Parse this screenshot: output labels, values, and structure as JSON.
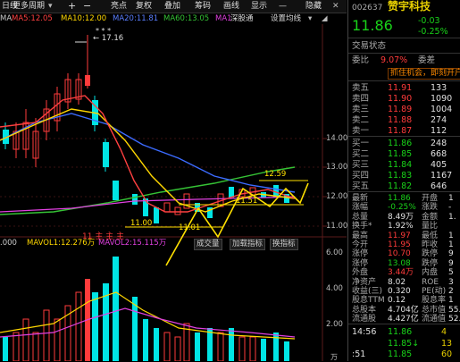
{
  "toolbar": {
    "items": [
      "日线",
      "更多周期",
      "+",
      "−",
      "亮点",
      "复权",
      "叠加",
      "筹码",
      "画线",
      "显示",
      "—",
      "隐藏"
    ],
    "dropdown_icon": "chevron-down-icon",
    "window_icons": [
      "close-icon",
      "layout-icon"
    ]
  },
  "ma_legend": {
    "prefix": "MA",
    "ma5": "MA5:12.05",
    "ma10": "MA10:12.00",
    "ma20": "MA20:11.81",
    "ma60": "MA60:13.05",
    "ma1": "MA1",
    "ma_tag": "深股通",
    "settings": "设置均线",
    "colors": {
      "ma5": "#ff4040",
      "ma10": "#ffd700",
      "ma20": "#3b6bff",
      "ma60": "#35c235",
      "ma1": "#e040e0"
    }
  },
  "chart": {
    "price_labels": [
      "14.00",
      "13.00",
      "12.00",
      "11.00"
    ],
    "max_label": "17.16",
    "right_label": "12.59",
    "low_label": "11.00",
    "low_label2": "11.01",
    "mid_label": "11.51",
    "red_mark": "11 主 主 主"
  },
  "volume": {
    "prefix": ".000",
    "mavol1": "MAVOL1:12.276万",
    "mavol2": "MAVOL2:15.115万",
    "buttons": [
      "成交量",
      "加载指标",
      "换指标"
    ],
    "axis_labels": [
      "6.00",
      "4.00",
      "2.00"
    ],
    "unit": "万"
  },
  "quote": {
    "code": "002637",
    "name": "赞宇科技",
    "price": "11.86",
    "change": "-0.03",
    "change_pct": "-0.25%",
    "trade_status_label": "交易状态",
    "weibi_label": "委比",
    "weibi": "9.07%",
    "weicha_label": "委差",
    "banner": "抓住机会，即刻开户！",
    "sells": [
      {
        "label": "卖五",
        "price": "11.91",
        "vol": "133"
      },
      {
        "label": "卖四",
        "price": "11.90",
        "vol": "1090"
      },
      {
        "label": "卖三",
        "price": "11.89",
        "vol": "1004"
      },
      {
        "label": "卖二",
        "price": "11.88",
        "vol": "274"
      },
      {
        "label": "卖一",
        "price": "11.87",
        "vol": "112"
      }
    ],
    "buys": [
      {
        "label": "买一",
        "price": "11.86",
        "vol": "248"
      },
      {
        "label": "买二",
        "price": "11.85",
        "vol": "668"
      },
      {
        "label": "买三",
        "price": "11.84",
        "vol": "405"
      },
      {
        "label": "买四",
        "price": "11.83",
        "vol": "1167"
      },
      {
        "label": "买五",
        "price": "11.82",
        "vol": "646"
      }
    ],
    "stats": [
      {
        "l": "最新",
        "v": "11.86",
        "l2": "开盘",
        "v2": "1"
      },
      {
        "l": "涨幅",
        "v": "-0.25%",
        "l2": "涨跌",
        "v2": "-"
      },
      {
        "l": "总量",
        "v": "8.49万",
        "l2": "金额",
        "v2": "1."
      },
      {
        "l": "换手*",
        "v": "1.92%",
        "l2": "量比",
        "v2": ""
      },
      {
        "l": "最高",
        "v": "11.97",
        "l2": "最低",
        "v2": "1"
      },
      {
        "l": "今开",
        "v": "11.95",
        "l2": "昨收",
        "v2": "1"
      },
      {
        "l": "涨停",
        "v": "10.70",
        "l2": "跌停",
        "v2": "9"
      },
      {
        "l": "涨停",
        "v": "13.08",
        "l2": "跌停",
        "v2": "9"
      },
      {
        "l": "外盘",
        "v": "3.44万",
        "l2": "内盘",
        "v2": "5"
      },
      {
        "l": "净资产",
        "v": "8.02",
        "l2": "ROE",
        "v2": "3"
      },
      {
        "l": "收益(三)",
        "v": "0.320",
        "l2": "PE(动)",
        "v2": "2"
      },
      {
        "l": "股息TTM",
        "v": "0.12",
        "l2": "股息率",
        "v2": "1"
      },
      {
        "l": "总股本",
        "v": "4.704亿",
        "l2": "总市值",
        "v2": "55.7"
      },
      {
        "l": "流通股",
        "v": "4.427亿",
        "l2": "流通值",
        "v2": "52.5"
      }
    ],
    "ticks": [
      {
        "time": "14:56",
        "price": "11.86",
        "vol": "4"
      },
      {
        "time": "",
        "price": "11.85↓",
        "vol": "13"
      },
      {
        "time": ":51",
        "price": "11.85",
        "vol": "60"
      }
    ]
  }
}
